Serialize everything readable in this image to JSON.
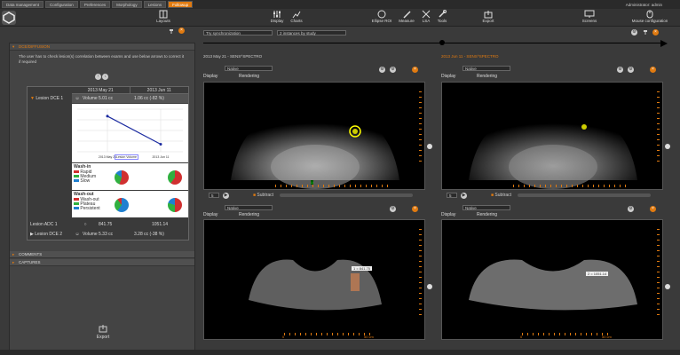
{
  "tabs": [
    "Data management",
    "Configuration",
    "Preferences",
    "Morphology",
    "Lesions",
    "Followup"
  ],
  "active_tab_index": 5,
  "user": {
    "label": "Administrator",
    "name": "admin"
  },
  "toolbar": {
    "layouts": "Layouts",
    "display": "Display",
    "charts": "Charts",
    "ellipse_roi": "Ellipse ROI",
    "measure": "Measure",
    "lsa": "LSA",
    "tools": "Tools",
    "export": "Export",
    "screens": "Screens",
    "mouse_config": "Mouse configuration"
  },
  "sync": {
    "selection": "Try synchronization",
    "instances": "2 instances by study"
  },
  "left": {
    "section1": "DCE/DIFFUSION",
    "info": "The user has to check lesion(s) correlation between exams and use below arrows to correct it if required",
    "dates": [
      "2013 May 21",
      "2013 Jun 11"
    ],
    "lesion1": {
      "name": "Lesion DCE 1",
      "volume_label": "Volume",
      "v1": "5.01 cc",
      "v2": "1.06 cc (-82 %)"
    },
    "chart_legend": "Lesion Volume",
    "washin": {
      "title": "Wash-in",
      "items": [
        "Rapid",
        "Medium",
        "Slow"
      ]
    },
    "washout": {
      "title": "Wash-out",
      "items": [
        "Wash-out",
        "Plateau",
        "Persistent"
      ]
    },
    "adc": {
      "name": "Lesion ADC 1",
      "v1": "841.75",
      "v2": "1051.14"
    },
    "lesion2": {
      "name": "Lesion DCE 2",
      "volume_label": "Volume",
      "v1": "5.33 cc",
      "v2": "3.28 cc (-38 %)"
    },
    "comments": "COMMENTS",
    "captures": "CAPTURES",
    "export": "Export"
  },
  "chart_data": {
    "type": "line",
    "x": [
      "2013 May 21",
      "2013 Jun 11"
    ],
    "series": [
      {
        "name": "Lesion Volume",
        "values": [
          5.01,
          1.06
        ]
      }
    ]
  },
  "viewers": {
    "left_title": "2013 May 21 - SENS^SPECTRO",
    "right_title": "2013 Jun 11 - SENS^SPECTRO",
    "native": "Native",
    "display": "Display",
    "rendering": "Rendering",
    "subtract": "Subtract",
    "frame": "5",
    "adc_left": "1 = 841.75",
    "adc_right": "2 = 1051.14",
    "lr": "Lt",
    "scale_left": "0",
    "scale_right": "50 cm"
  },
  "colors": {
    "accent": "#e07a10",
    "red": "#d03030",
    "green": "#30b040",
    "blue": "#2080d0"
  }
}
